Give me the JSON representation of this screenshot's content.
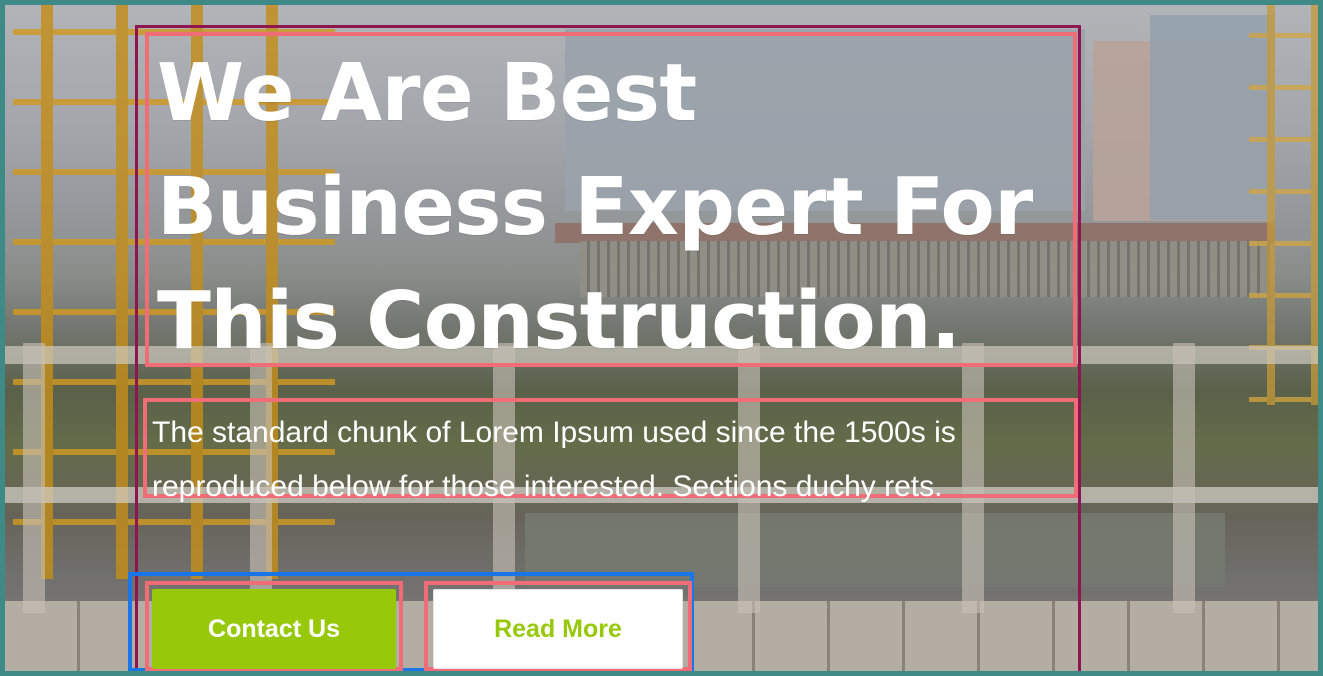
{
  "hero": {
    "headline": "We Are Best Business Expert For This Construction.",
    "description": "The standard chunk of Lorem Ipsum used since the 1500s is reproduced below for those interested. Sections duchy rets.",
    "buttons": {
      "contact_label": "Contact Us",
      "read_more_label": "Read More"
    }
  },
  "colors": {
    "accent": "#97c90a",
    "text": "#ffffff",
    "button_secondary_bg": "#ffffff"
  }
}
